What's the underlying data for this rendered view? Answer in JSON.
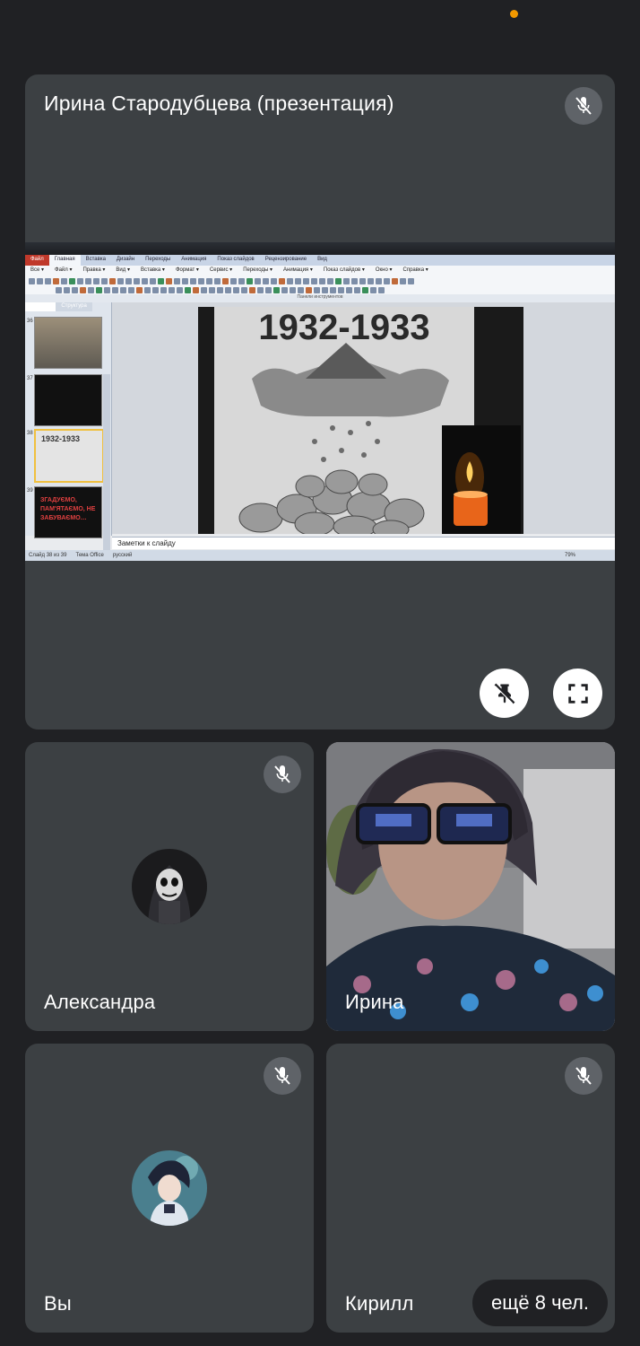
{
  "colors": {
    "accent": "#f29900",
    "tile": "#3c4043",
    "background": "#202124",
    "mute_bg": "#5f6368"
  },
  "presentation": {
    "presenter": "Ирина Стародубцева (презентация)",
    "app": {
      "title": "",
      "tabs": [
        "Файл",
        "Главная",
        "Вставка",
        "Дизайн",
        "Переходы",
        "Анимация",
        "Показ слайдов",
        "Рецензирование",
        "Вид"
      ],
      "menu": [
        "Все ▾",
        "Файл ▾",
        "Правка ▾",
        "Вид ▾",
        "Вставка ▾",
        "Формат ▾",
        "Сервис ▾",
        "Переходы ▾",
        "Анимация ▾",
        "Показ слайдов ▾",
        "Окно ▾",
        "Справка ▾"
      ],
      "toolbar_group": "Панели инструментов",
      "panel_tabs": [
        "Слайды",
        "Структура"
      ],
      "thumbnails": [
        {
          "num": "36"
        },
        {
          "num": "37"
        },
        {
          "num": "38",
          "text": "1932-1933"
        },
        {
          "num": "39",
          "text": "ЗГАДУЄМО, ПАМ'ЯТАЄМО, НЕ ЗАБУВАЄМО…"
        }
      ],
      "slide_title": "1932-1933",
      "notes": "Заметки к слайду",
      "status": [
        "Слайд 38 из 39",
        "Тема Office",
        "русский"
      ],
      "zoom": "79%"
    }
  },
  "participants": [
    {
      "name": "Александра",
      "muted": true
    },
    {
      "name": "Ирина",
      "muted": false
    },
    {
      "name": "Вы",
      "muted": true
    },
    {
      "name": "Кирилл",
      "muted": true
    }
  ],
  "more": "ещё 8 чел.",
  "icons": {
    "mic_off": "mic-off-icon",
    "unpin": "unpin-icon",
    "fullscreen": "fullscreen-icon"
  }
}
